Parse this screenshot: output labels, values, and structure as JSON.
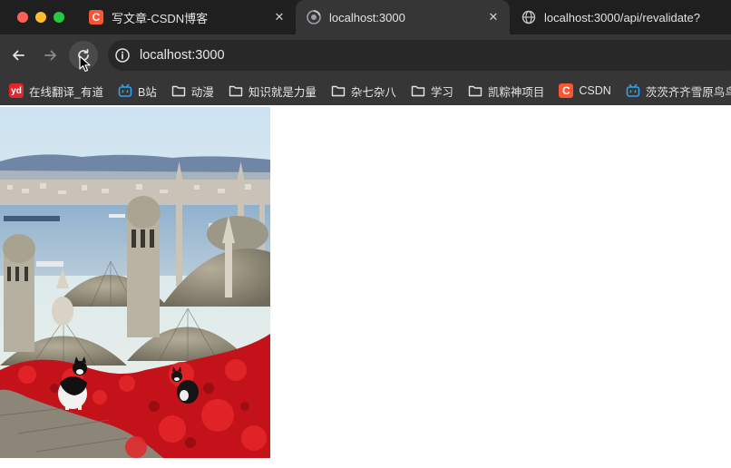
{
  "window": {
    "controls": [
      "close",
      "minimize",
      "maximize"
    ]
  },
  "tabs": [
    {
      "title": "写文章-CSDN博客",
      "icon": "csdn-icon",
      "icon_text": "C",
      "active": false
    },
    {
      "title": "localhost:3000",
      "icon": "chromium-icon",
      "active": true
    },
    {
      "title": "localhost:3000/api/revalidate?",
      "icon": "globe-icon",
      "active": false
    }
  ],
  "toolbar": {
    "url": "localhost:3000"
  },
  "bookmarks": [
    {
      "label": "在线翻译_有道",
      "icon": "youdao-icon",
      "icon_text": "yd"
    },
    {
      "label": "B站",
      "icon": "bilibili-icon"
    },
    {
      "label": "动漫",
      "icon": "folder-icon"
    },
    {
      "label": "知识就是力量",
      "icon": "folder-icon"
    },
    {
      "label": "杂七杂八",
      "icon": "folder-icon"
    },
    {
      "label": "学习",
      "icon": "folder-icon"
    },
    {
      "label": "凯粽神项目",
      "icon": "folder-icon"
    },
    {
      "label": "CSDN",
      "icon": "csdn-icon",
      "icon_text": "C"
    },
    {
      "label": "茨茨齐齐雪原鸟鸟",
      "icon": "bilibili-icon"
    }
  ],
  "content": {
    "image_subject": "domes-and-minarets-with-cats-and-red-leaves"
  },
  "colors": {
    "tabstrip_bg": "#1f1f1f",
    "toolbar_bg": "#363636",
    "omnibox_bg": "#282828",
    "text": "#e3e3e3",
    "csdn_red": "#fc5531",
    "bilibili_blue": "#2ba6e8"
  }
}
